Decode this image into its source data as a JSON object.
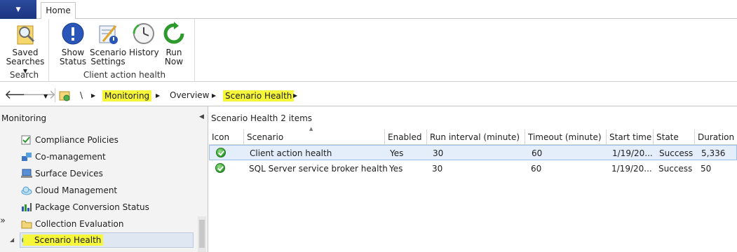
{
  "tabs": {
    "home": "Home"
  },
  "ribbon": {
    "search_group": {
      "label": "Search",
      "saved_searches": "Saved\nSearches ▾"
    },
    "client_group": {
      "label": "Client action health",
      "show_status": "Show\nStatus",
      "scenario_settings": "Scenario\nSettings",
      "history": "History",
      "run_now": "Run\nNow"
    }
  },
  "breadcrumb": {
    "root": "\\",
    "items": [
      "Monitoring",
      "Overview",
      "Scenario Health"
    ]
  },
  "nav": {
    "header": "Monitoring",
    "items": [
      {
        "label": "Compliance Policies",
        "icon": "compliance-icon"
      },
      {
        "label": "Co-management",
        "icon": "co-management-icon"
      },
      {
        "label": "Surface Devices",
        "icon": "surface-icon"
      },
      {
        "label": "Cloud Management",
        "icon": "cloud-icon"
      },
      {
        "label": "Package Conversion Status",
        "icon": "chart-icon"
      },
      {
        "label": "Collection Evaluation",
        "icon": "folder-icon"
      },
      {
        "label": "Scenario Health",
        "icon": "scenario-health-icon"
      }
    ]
  },
  "list": {
    "title": "Scenario Health",
    "count": "2 items",
    "columns": [
      "Icon",
      "Scenario",
      "Enabled",
      "Run interval (minute)",
      "Timeout (minute)",
      "Start time",
      "State",
      "Duration ("
    ],
    "rows": [
      {
        "scenario": "Client action health",
        "enabled": "Yes",
        "run_interval": "30",
        "timeout": "60",
        "start": "1/19/20...",
        "state": "Success",
        "duration": "5,336"
      },
      {
        "scenario": "SQL Server service broker health",
        "enabled": "Yes",
        "run_interval": "30",
        "timeout": "60",
        "start": "1/19/20...",
        "state": "Success",
        "duration": "50"
      }
    ]
  },
  "colors": {
    "highlight": "#f6f63a",
    "accent": "#1c3580"
  }
}
